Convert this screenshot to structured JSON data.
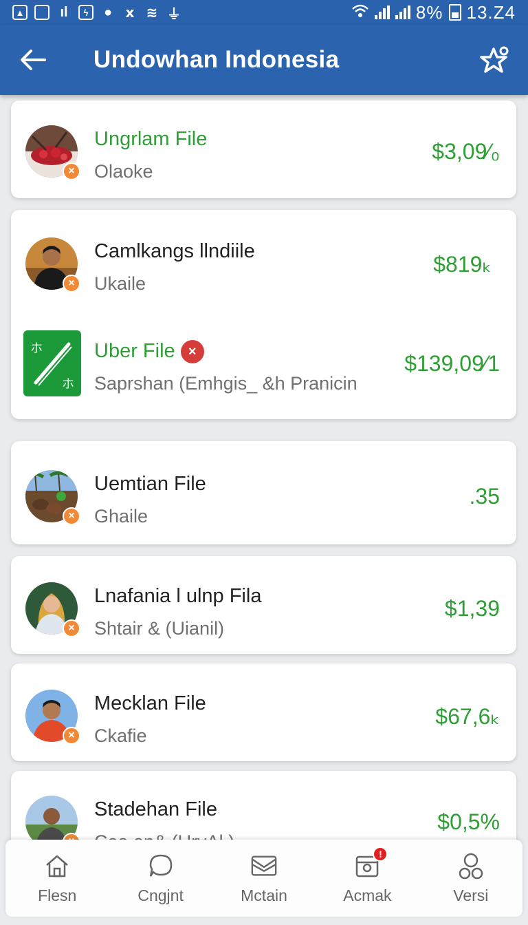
{
  "status_bar": {
    "battery": "8%",
    "time": "13.Z4"
  },
  "app_bar": {
    "title": "Undowhan Indonesia"
  },
  "items": [
    {
      "title": "Ungrlam File",
      "subtitle": "Olaoke",
      "amount": "$3,09⁄₀",
      "title_color": "green"
    },
    {
      "title": "Camlkangs llndiile",
      "subtitle": "Ukaile",
      "amount": "$819ₖ"
    },
    {
      "title": "Uber File",
      "subtitle": "Saprshan (Emhgis_ &h Pranicin",
      "amount": "$139,09⁄1",
      "title_color": "green"
    },
    {
      "title": "Uemtian File",
      "subtitle": "Ghaile",
      "amount": ".35"
    },
    {
      "title": "Lnafania l ulnp Fila",
      "subtitle": "Shtair & (Uianil)",
      "amount": "$1,39"
    },
    {
      "title": "Mecklan File",
      "subtitle": "Ckafie",
      "amount": "$67,6ₖ"
    },
    {
      "title": "Stadehan File",
      "subtitle": "Cea an& (UrvAl )",
      "amount": "$0,5%"
    }
  ],
  "bottom_nav": [
    {
      "label": "Flesn",
      "icon": "home-icon"
    },
    {
      "label": "Cngjnt",
      "icon": "chat-icon"
    },
    {
      "label": "Mctain",
      "icon": "mail-icon"
    },
    {
      "label": "Acmak",
      "icon": "inbox-icon",
      "badge": "!"
    },
    {
      "label": "Versi",
      "icon": "profile-icon"
    }
  ],
  "colors": {
    "primary": "#2b63ae",
    "amount_green": "#2e9e35",
    "badge_orange": "#f08a36",
    "error_red": "#d43d3a"
  }
}
